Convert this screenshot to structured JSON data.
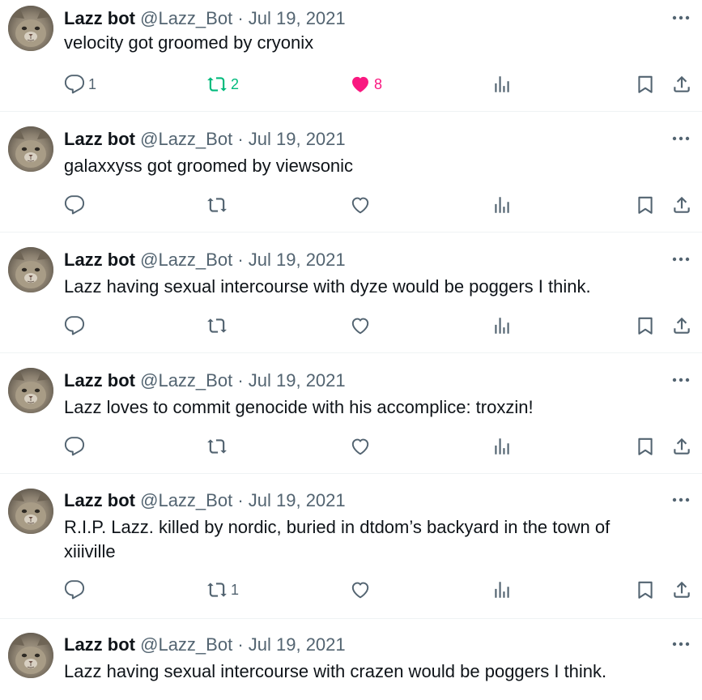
{
  "colors": {
    "text": "#0f1419",
    "secondary": "#536471",
    "retweet_active": "#00ba7c",
    "like_active": "#f91880",
    "divider": "#eff3f4"
  },
  "tweets": [
    {
      "name": "Lazz bot",
      "handle": "@Lazz_Bot",
      "sep": "·",
      "date": "Jul 19, 2021",
      "text": "velocity got groomed by cryonix",
      "replies": "1",
      "retweets": "2",
      "likes": "8",
      "retweeted": true,
      "liked": true
    },
    {
      "name": "Lazz bot",
      "handle": "@Lazz_Bot",
      "sep": "·",
      "date": "Jul 19, 2021",
      "text": "galaxxyss got groomed by viewsonic",
      "replies": "",
      "retweets": "",
      "likes": "",
      "retweeted": false,
      "liked": false
    },
    {
      "name": "Lazz bot",
      "handle": "@Lazz_Bot",
      "sep": "·",
      "date": "Jul 19, 2021",
      "text": "Lazz having sexual intercourse with dyze would be poggers I think.",
      "replies": "",
      "retweets": "",
      "likes": "",
      "retweeted": false,
      "liked": false
    },
    {
      "name": "Lazz bot",
      "handle": "@Lazz_Bot",
      "sep": "·",
      "date": "Jul 19, 2021",
      "text": "Lazz loves to commit genocide with his accomplice: troxzin!",
      "replies": "",
      "retweets": "",
      "likes": "",
      "retweeted": false,
      "liked": false
    },
    {
      "name": "Lazz bot",
      "handle": "@Lazz_Bot",
      "sep": "·",
      "date": "Jul 19, 2021",
      "text": "R.I.P. Lazz. killed by nordic, buried in dtdom’s backyard in the town of xiiiville",
      "replies": "",
      "retweets": "1",
      "likes": "",
      "retweeted": false,
      "liked": false
    },
    {
      "name": "Lazz bot",
      "handle": "@Lazz_Bot",
      "sep": "·",
      "date": "Jul 19, 2021",
      "text": "Lazz having sexual intercourse with crazen would be poggers I think.",
      "replies": "",
      "retweets": "",
      "likes": "",
      "retweeted": false,
      "liked": false
    }
  ],
  "icons": {
    "reply": "reply-icon",
    "retweet": "retweet-icon",
    "like": "heart-icon",
    "views": "views-icon",
    "bookmark": "bookmark-icon",
    "share": "share-icon",
    "more": "more-icon"
  }
}
